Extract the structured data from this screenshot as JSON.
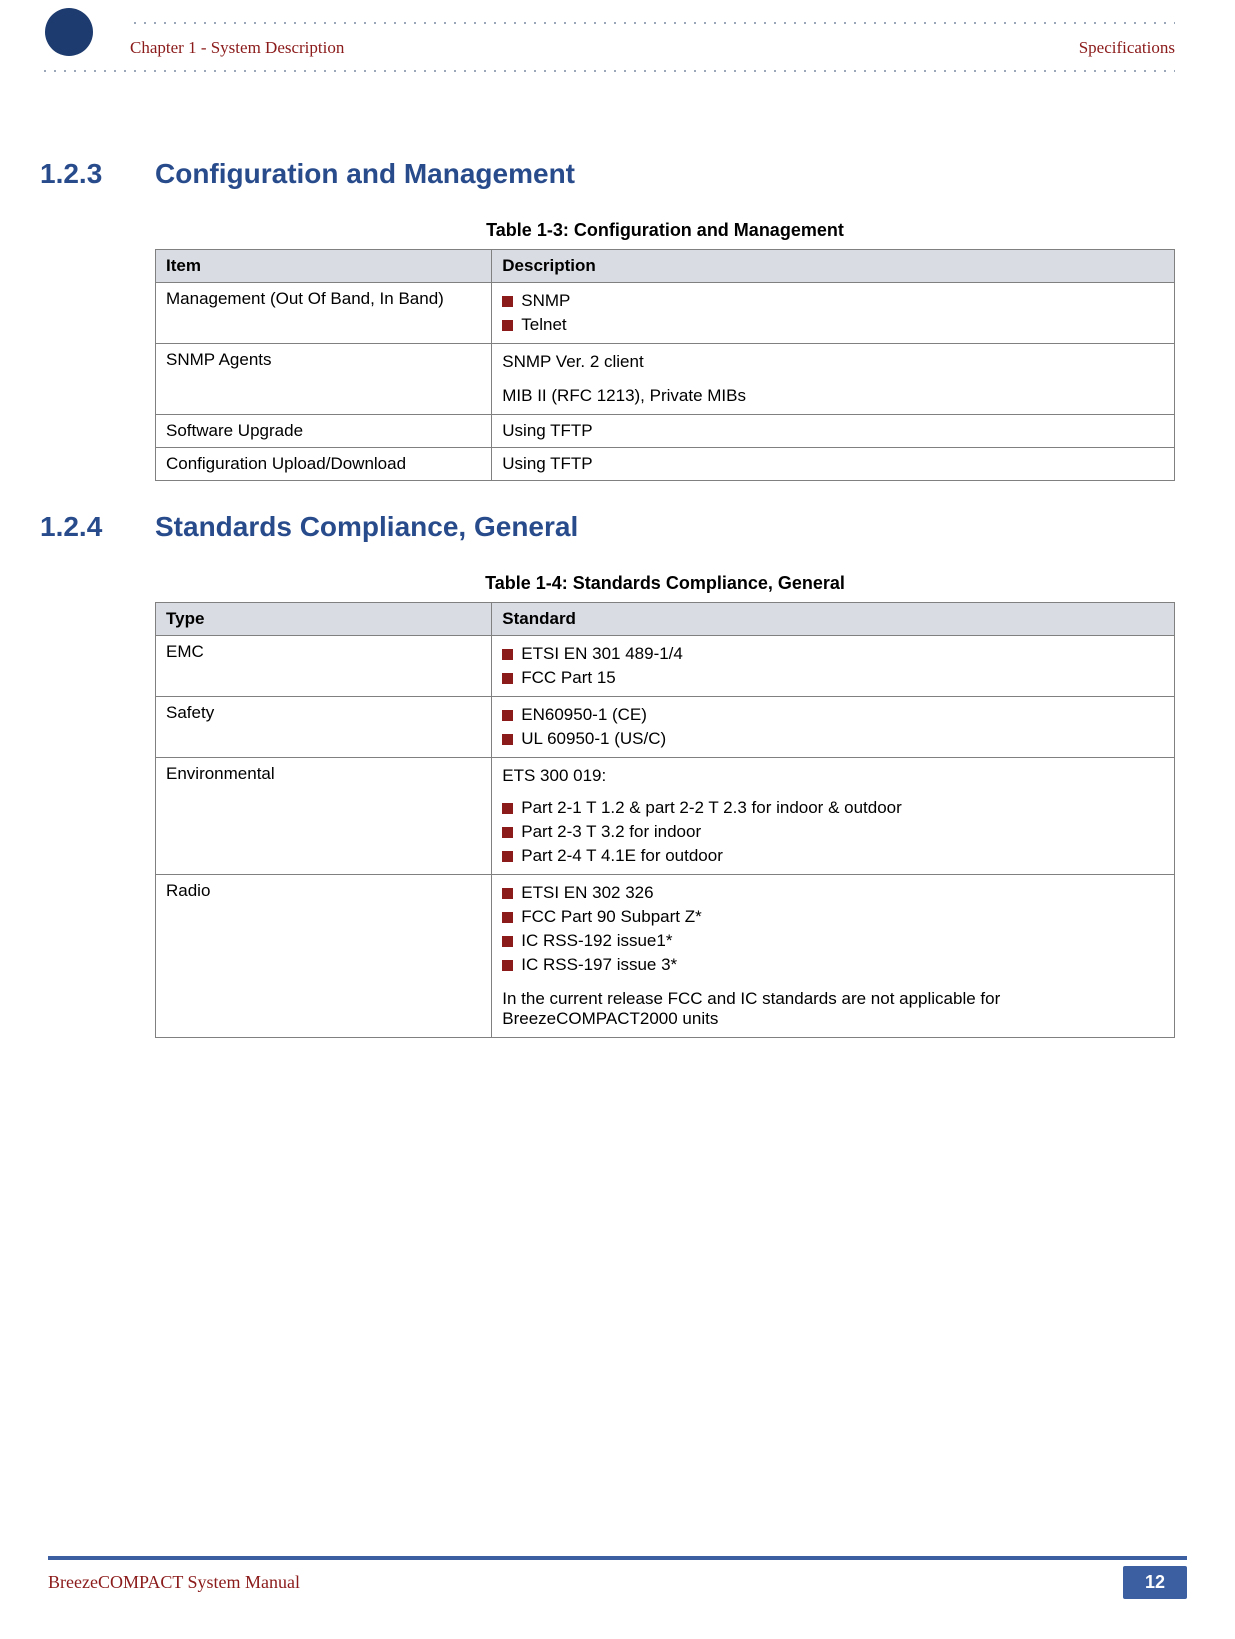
{
  "header": {
    "chapter": "Chapter 1 - System Description",
    "right": "Specifications"
  },
  "section1": {
    "num": "1.2.3",
    "title": "Configuration and Management",
    "caption": "Table 1-3: Configuration and Management",
    "col1": "Item",
    "col2": "Description",
    "rows": {
      "r1": {
        "item": "Management (Out Of Band, In Band)",
        "b1": "SNMP",
        "b2": "Telnet"
      },
      "r2": {
        "item": "SNMP Agents",
        "l1": "SNMP Ver. 2 client",
        "l2": "MIB II (RFC 1213), Private MIBs"
      },
      "r3": {
        "item": "Software Upgrade",
        "desc": "Using TFTP"
      },
      "r4": {
        "item": "Configuration Upload/Download",
        "desc": "Using TFTP"
      }
    }
  },
  "section2": {
    "num": "1.2.4",
    "title": "Standards Compliance, General",
    "caption": "Table 1-4: Standards Compliance, General",
    "col1": "Type",
    "col2": "Standard",
    "rows": {
      "emc": {
        "type": "EMC",
        "b1": "ETSI EN 301 489-1/4",
        "b2": "FCC Part 15"
      },
      "safety": {
        "type": "Safety",
        "b1": "EN60950-1 (CE)",
        "b2": "UL 60950-1 (US/C)"
      },
      "env": {
        "type": "Environmental",
        "lead": "ETS 300 019:",
        "b1": "Part 2-1 T 1.2 & part 2-2 T 2.3 for indoor & outdoor",
        "b2": "Part 2-3 T 3.2 for indoor",
        "b3": "Part 2-4 T 4.1E for outdoor"
      },
      "radio": {
        "type": "Radio",
        "b1": "ETSI EN 302 326",
        "b2": "FCC Part 90 Subpart Z*",
        "b3": "IC RSS-192 issue1*",
        "b4": "IC RSS-197 issue 3*",
        "note": "In the current release FCC and IC standards are not applicable for BreezeCOMPACT2000 units"
      }
    }
  },
  "footer": {
    "manual": "BreezeCOMPACT System Manual",
    "page": "12"
  }
}
